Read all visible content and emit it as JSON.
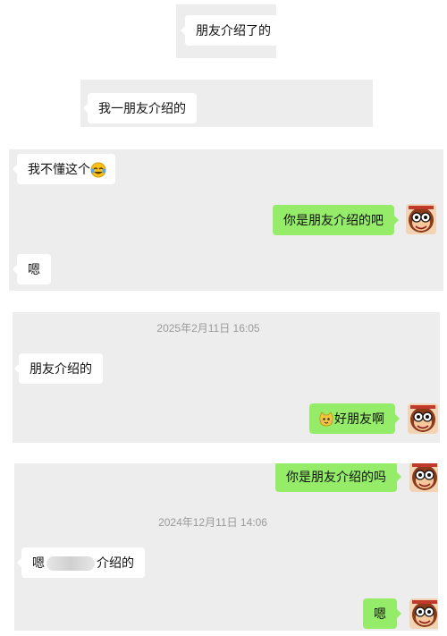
{
  "chat": {
    "snippet1": {
      "text": "朋友介绍了的"
    },
    "snippet2": {
      "text": "我一朋友介绍的"
    },
    "snippet3": {
      "msg1": "我不懂这个",
      "msg1_emoji": "laughing-tears-emoji-icon",
      "msg2": "你是朋友介绍的吧",
      "msg3": "嗯"
    },
    "snippet4": {
      "timestamp": "2025年2月11日 16:05",
      "msg1": "朋友介绍的",
      "msg2": "好朋友啊",
      "msg2_emoji": "cat-face-emoji-icon"
    },
    "snippet5": {
      "msg1": "你是朋友介绍的吗",
      "timestamp": "2024年12月11日 14:06",
      "msg2_prefix": "嗯",
      "msg2_suffix": "介绍的",
      "msg3": "嗯"
    }
  },
  "colors": {
    "panel_bg": "#ededed",
    "incoming_bubble": "#ffffff",
    "outgoing_bubble": "#95ec69",
    "timestamp_text": "#9a9a9a"
  },
  "avatar_icon": "monkey-avatar-icon"
}
